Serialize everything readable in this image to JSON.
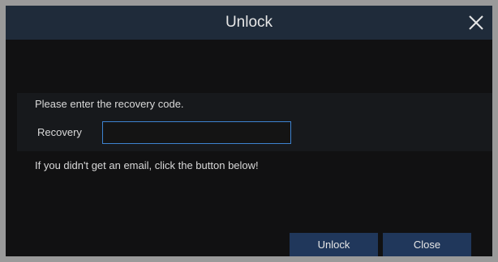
{
  "dialog": {
    "title": "Unlock",
    "close_icon": "close-icon"
  },
  "form": {
    "prompt": "Please enter the recovery code.",
    "recovery_label": "Recovery",
    "recovery_value": "",
    "recovery_placeholder": "",
    "hint": "If you didn't get an email, click the button below!"
  },
  "buttons": {
    "unlock_label": "Unlock",
    "close_label": "Close"
  },
  "colors": {
    "titlebar": "#1f2b3a",
    "background": "#111112",
    "input_border": "#3d82d0",
    "button": "#20375b"
  }
}
